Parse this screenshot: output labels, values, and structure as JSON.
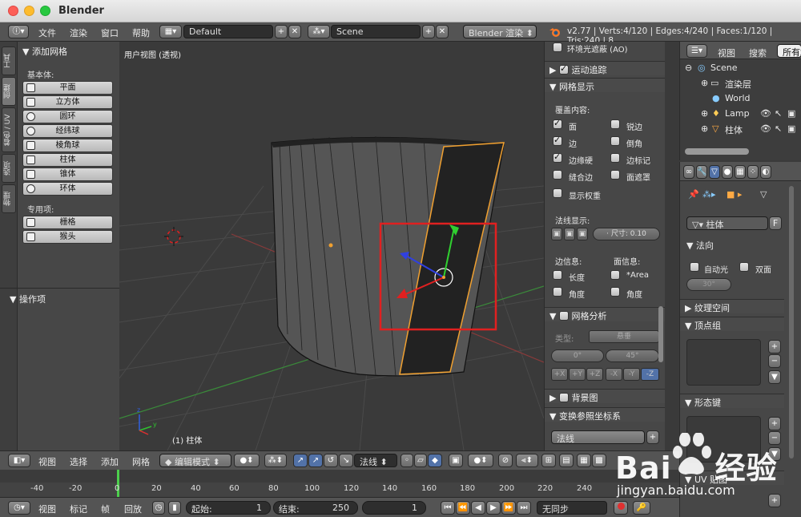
{
  "window": {
    "title": "Blender"
  },
  "topbar": {
    "menus": [
      "文件",
      "渲染",
      "窗口",
      "帮助"
    ],
    "layout_name": "Default",
    "scene_name": "Scene",
    "render_engine": "Blender 渲染",
    "stats": "v2.77 | Verts:4/120 | Edges:4/240 | Faces:1/120 | Tris:240 | 8"
  },
  "vtabs": [
    "工具",
    "创建",
    "着色 / UV",
    "选项",
    "物理"
  ],
  "toolshelf": {
    "header": "添加网格",
    "basic_label": "基本体:",
    "basic_items": [
      "平面",
      "立方体",
      "圆环",
      "经纬球",
      "棱角球",
      "柱体",
      "锥体",
      "环体"
    ],
    "special_label": "专用项:",
    "special_items": [
      "栅格",
      "猴头"
    ],
    "operator_header": "操作项"
  },
  "viewport": {
    "label": "用户视图 (透视)",
    "object_label": "(1) 柱体"
  },
  "npanel": {
    "ao": "环境光遮蔽 (AO)",
    "motion_tracking": "运动追踪",
    "mesh_display": "网格显示",
    "overlay_label": "覆盖内容:",
    "overlays": [
      {
        "label": "面",
        "on": true
      },
      {
        "label": "锐边",
        "on": false
      },
      {
        "label": "边",
        "on": true
      },
      {
        "label": "倒角",
        "on": false
      },
      {
        "label": "边缘硬",
        "on": true
      },
      {
        "label": "边标记",
        "on": false
      },
      {
        "label": "缝合边",
        "on": false
      },
      {
        "label": "面遮罩",
        "on": false
      }
    ],
    "show_weight": "显示权重",
    "normals_label": "法线显示:",
    "size_label": "· 尺寸: 0.10",
    "edge_info": "边信息:",
    "face_info": "面信息:",
    "edge_info_items": [
      "长度",
      "角度"
    ],
    "face_info_items": [
      "*Area",
      "角度"
    ],
    "mesh_analysis": "网格分析",
    "type_label": "类型:",
    "type_value": "悬垂",
    "angle_min": "0°",
    "angle_max": "45°",
    "axes": [
      "+X",
      "+Y",
      "+Z",
      "-X",
      "-Y",
      "-Z"
    ],
    "background": "背景图",
    "transform_orient": "变换参照坐标系",
    "orient_value": "法线"
  },
  "outliner": {
    "tabs": [
      "视图",
      "搜索",
      "所有场"
    ],
    "rows": [
      "Scene",
      "渲染层",
      "World",
      "Lamp",
      "柱体"
    ]
  },
  "props": {
    "mesh_name": "柱体",
    "fake_user": "F",
    "normals_head": "法向",
    "auto_smooth": "自动光",
    "double_sided": "双面",
    "angle": "30°",
    "texture_space": "纹理空间",
    "vertex_groups": "顶点组",
    "shape_keys": "形态键",
    "uv_maps": "UV 贴图"
  },
  "vp_header": {
    "menus": [
      "视图",
      "选择",
      "添加",
      "网格"
    ],
    "mode": "编辑模式",
    "orientation": "法线"
  },
  "timeline": {
    "ticks": [
      "-40",
      "-20",
      "0",
      "20",
      "40",
      "60",
      "80",
      "100",
      "120",
      "140",
      "160",
      "180",
      "200",
      "220",
      "240"
    ],
    "menus": [
      "视图",
      "标记",
      "帧",
      "回放"
    ],
    "start_label": "起始:",
    "start_value": "1",
    "end_label": "结束:",
    "end_value": "250",
    "current_frame": "1",
    "sync": "无同步"
  },
  "watermark": {
    "brand": "Bai",
    "brand2": "经验",
    "url": "jingyan.baidu.com"
  },
  "colors": {
    "selection_orange": "#f0a030",
    "highlight_red": "#e02020",
    "gizmo_green": "#30d030"
  }
}
